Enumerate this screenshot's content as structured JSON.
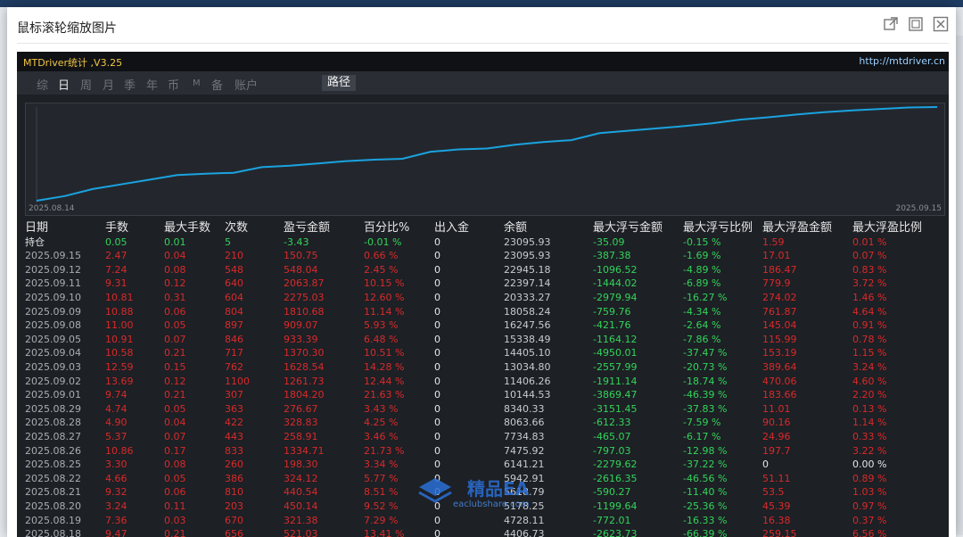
{
  "modal": {
    "title": "鼠标滚轮缩放图片",
    "icons": [
      "external-link-icon",
      "maximize-icon",
      "close-icon"
    ]
  },
  "app": {
    "title": "MTDriver统计 ,V3.25",
    "url": "http://mtdriver.cn",
    "tabs": [
      {
        "label": "综",
        "active": false
      },
      {
        "label": "日",
        "active": true
      },
      {
        "label": "周",
        "active": false
      },
      {
        "label": "月",
        "active": false
      },
      {
        "label": "季",
        "active": false
      },
      {
        "label": "年",
        "active": false
      },
      {
        "label": "币",
        "active": false
      },
      {
        "label": "M",
        "active": false
      },
      {
        "label": "备",
        "active": false
      },
      {
        "label": "账户",
        "active": false
      }
    ],
    "path_button": "路径"
  },
  "chart_data": {
    "type": "line",
    "x_start_label": "2025.08.14",
    "x_end_label": "2025.09.15",
    "series": [
      {
        "values": [
          3.0,
          4.0,
          5.5,
          6.5,
          7.5,
          8.5,
          8.8,
          9.0,
          10.2,
          10.5,
          11.0,
          11.5,
          11.8,
          12.0,
          13.5,
          14.0,
          14.2,
          15.0,
          15.6,
          16.0,
          17.5,
          18.0,
          18.5,
          19.0,
          19.6,
          20.4,
          20.9,
          21.5,
          22.0,
          22.4,
          22.7,
          23.0,
          23.1
        ]
      }
    ],
    "line_color": "#1aa3e0",
    "grid": false
  },
  "table": {
    "headers": [
      "日期",
      "手数",
      "最大手数",
      "次数",
      "盈亏金额",
      "百分比%",
      "出入金",
      "余额",
      "最大浮亏金额",
      "最大浮亏比例",
      "最大浮盈金额",
      "最大浮盈比例"
    ],
    "holding": [
      "持仓",
      "0.05",
      "0.01",
      "5",
      "-3.43",
      "-0.01 %",
      "0",
      "23095.93",
      "-35.09",
      "-0.15 %",
      "1.59",
      "0.01 %"
    ],
    "rows": [
      [
        "2025.09.15",
        "2.47",
        "0.04",
        "210",
        "150.75",
        "0.66 %",
        "0",
        "23095.93",
        "-387.38",
        "-1.69 %",
        "17.01",
        "0.07 %"
      ],
      [
        "2025.09.12",
        "7.24",
        "0.08",
        "548",
        "548.04",
        "2.45 %",
        "0",
        "22945.18",
        "-1096.52",
        "-4.89 %",
        "186.47",
        "0.83 %"
      ],
      [
        "2025.09.11",
        "9.31",
        "0.12",
        "640",
        "2063.87",
        "10.15 %",
        "0",
        "22397.14",
        "-1444.02",
        "-6.89 %",
        "779.9",
        "3.72 %"
      ],
      [
        "2025.09.10",
        "10.81",
        "0.31",
        "604",
        "2275.03",
        "12.60 %",
        "0",
        "20333.27",
        "-2979.94",
        "-16.27 %",
        "274.02",
        "1.46 %"
      ],
      [
        "2025.09.09",
        "10.88",
        "0.06",
        "804",
        "1810.68",
        "11.14 %",
        "0",
        "18058.24",
        "-759.76",
        "-4.34 %",
        "761.87",
        "4.64 %"
      ],
      [
        "2025.09.08",
        "11.00",
        "0.05",
        "897",
        "909.07",
        "5.93 %",
        "0",
        "16247.56",
        "-421.76",
        "-2.64 %",
        "145.04",
        "0.91 %"
      ],
      [
        "2025.09.05",
        "10.91",
        "0.07",
        "846",
        "933.39",
        "6.48 %",
        "0",
        "15338.49",
        "-1164.12",
        "-7.86 %",
        "115.99",
        "0.78 %"
      ],
      [
        "2025.09.04",
        "10.58",
        "0.21",
        "717",
        "1370.30",
        "10.51 %",
        "0",
        "14405.10",
        "-4950.01",
        "-37.47 %",
        "153.19",
        "1.15 %"
      ],
      [
        "2025.09.03",
        "12.59",
        "0.15",
        "762",
        "1628.54",
        "14.28 %",
        "0",
        "13034.80",
        "-2557.99",
        "-20.73 %",
        "389.64",
        "3.24 %"
      ],
      [
        "2025.09.02",
        "13.69",
        "0.12",
        "1100",
        "1261.73",
        "12.44 %",
        "0",
        "11406.26",
        "-1911.14",
        "-18.74 %",
        "470.06",
        "4.60 %"
      ],
      [
        "2025.09.01",
        "9.74",
        "0.21",
        "307",
        "1804.20",
        "21.63 %",
        "0",
        "10144.53",
        "-3869.47",
        "-46.39 %",
        "183.66",
        "2.20 %"
      ],
      [
        "2025.08.29",
        "4.74",
        "0.05",
        "363",
        "276.67",
        "3.43 %",
        "0",
        "8340.33",
        "-3151.45",
        "-37.83 %",
        "11.01",
        "0.13 %"
      ],
      [
        "2025.08.28",
        "4.90",
        "0.04",
        "422",
        "328.83",
        "4.25 %",
        "0",
        "8063.66",
        "-612.33",
        "-7.59 %",
        "90.16",
        "1.14 %"
      ],
      [
        "2025.08.27",
        "5.37",
        "0.07",
        "443",
        "258.91",
        "3.46 %",
        "0",
        "7734.83",
        "-465.07",
        "-6.17 %",
        "24.96",
        "0.33 %"
      ],
      [
        "2025.08.26",
        "10.86",
        "0.17",
        "833",
        "1334.71",
        "21.73 %",
        "0",
        "7475.92",
        "-797.03",
        "-12.98 %",
        "197.7",
        "3.22 %"
      ],
      [
        "2025.08.25",
        "3.30",
        "0.08",
        "260",
        "198.30",
        "3.34 %",
        "0",
        "6141.21",
        "-2279.62",
        "-37.22 %",
        "0",
        "0.00 %"
      ],
      [
        "2025.08.22",
        "4.66",
        "0.05",
        "386",
        "324.12",
        "5.77 %",
        "0",
        "5942.91",
        "-2616.35",
        "-46.56 %",
        "51.11",
        "0.89 %"
      ],
      [
        "2025.08.21",
        "9.32",
        "0.06",
        "810",
        "440.54",
        "8.51 %",
        "0",
        "5618.79",
        "-590.27",
        "-11.40 %",
        "53.5",
        "1.03 %"
      ],
      [
        "2025.08.20",
        "3.24",
        "0.11",
        "203",
        "450.14",
        "9.52 %",
        "0",
        "5178.25",
        "-1199.64",
        "-25.36 %",
        "45.39",
        "0.97 %"
      ],
      [
        "2025.08.19",
        "7.36",
        "0.03",
        "670",
        "321.38",
        "7.29 %",
        "0",
        "4728.11",
        "-772.01",
        "-16.33 %",
        "16.38",
        "0.37 %"
      ],
      [
        "2025.08.18",
        "9.47",
        "0.21",
        "656",
        "521.03",
        "13.41 %",
        "0",
        "4406.73",
        "-2623.73",
        "-66.39 %",
        "259.15",
        "6.56 %"
      ]
    ]
  },
  "watermark": {
    "main": "精品EA",
    "sub": "eaclubshare.com"
  },
  "colors": {
    "positive": "#d92a2a",
    "negative": "#33d35a",
    "date": "#a9adb3",
    "balance": "#c8cbd0"
  }
}
